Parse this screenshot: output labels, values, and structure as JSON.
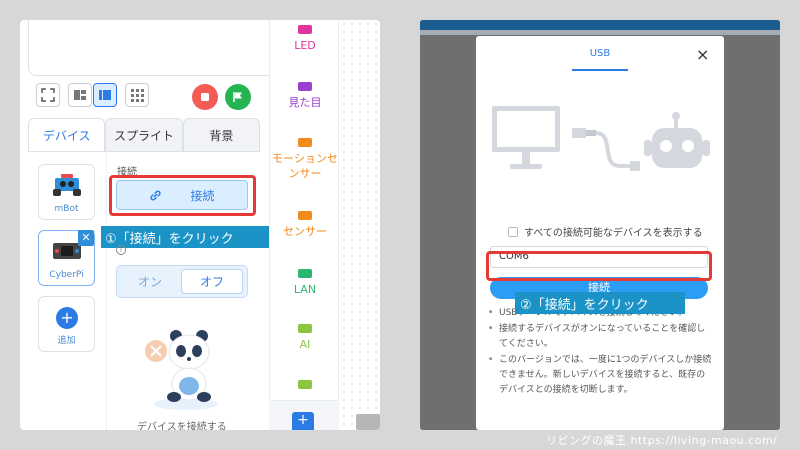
{
  "left_panel": {
    "tabs": [
      {
        "label": "デバイス",
        "active": true
      },
      {
        "label": "スプライト",
        "active": false
      },
      {
        "label": "背景",
        "active": false
      }
    ],
    "devices": [
      {
        "label": "mBot"
      },
      {
        "label": "CyberPi"
      },
      {
        "label": "追加"
      }
    ],
    "connection_title": "接続",
    "connect_button": "接続",
    "callout_1": "①「接続」をクリック",
    "toggle_on": "オン",
    "toggle_off": "オフ",
    "empty_hint": "デバイスを接続する",
    "categories": [
      {
        "label": "LED",
        "color": "#e0359b"
      },
      {
        "label": "見た目",
        "color": "#9b3fd0"
      },
      {
        "label": "モーションセンサー",
        "color": "#f28a1c"
      },
      {
        "label": "センサー",
        "color": "#f28a1c"
      },
      {
        "label": "LAN",
        "color": "#2bb673"
      },
      {
        "label": "AI",
        "color": "#8cc63f"
      },
      {
        "label": "",
        "color": "#8cc63f"
      }
    ]
  },
  "dialog": {
    "tab_label": "USB",
    "close_label": "×",
    "show_all_label": "すべての接続可能なデバイスを表示する",
    "port_value": "COM6",
    "connect_button": "接続",
    "callout_2": "②「接続」をクリック",
    "notes": [
      "USBケーブルでデバイスを接続してください。",
      "接続するデバイスがオンになっていることを確認してください。",
      "このバージョンでは、一度に1つのデバイスしか接続できません。新しいデバイスを接続すると、既存のデバイスとの接続を切断します。"
    ]
  },
  "footer": {
    "credit": "リビングの魔王 https://living-maou.com/"
  },
  "colors": {
    "accent": "#2c7be5",
    "callout_bg": "#1b93c7",
    "highlight": "#e53935",
    "stop": "#f25c54",
    "go": "#26b352"
  }
}
